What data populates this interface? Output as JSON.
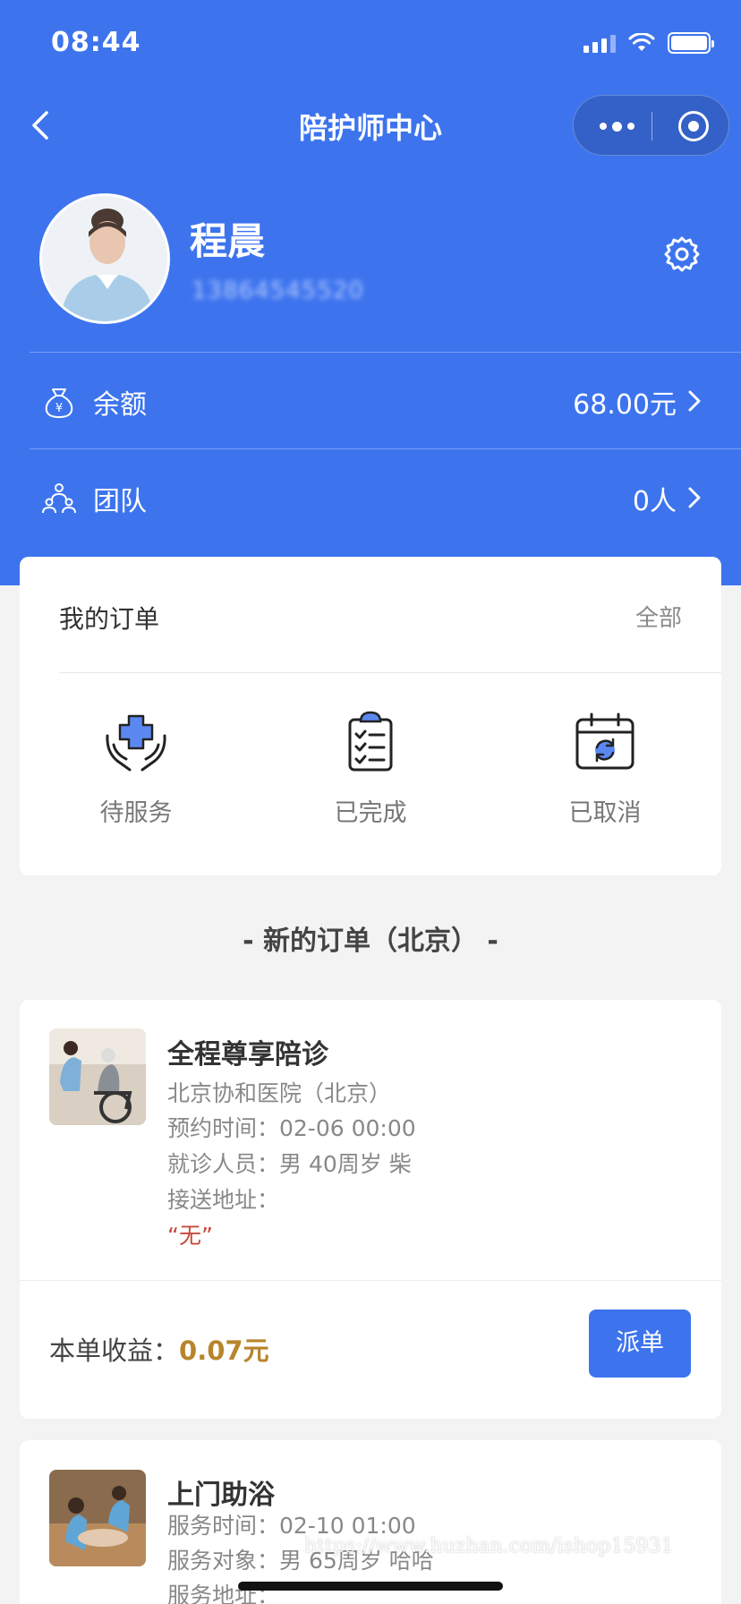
{
  "status_bar": {
    "time": "08:44"
  },
  "nav": {
    "title": "陪护师中心"
  },
  "profile": {
    "name": "程晨",
    "phone": "13864545520"
  },
  "menu": {
    "balance": {
      "label": "余额",
      "value": "68.00元"
    },
    "team": {
      "label": "团队",
      "value": "0人"
    }
  },
  "orders": {
    "title": "我的订单",
    "all_label": "全部",
    "items": [
      {
        "label": "待服务",
        "icon": "medical-care-icon"
      },
      {
        "label": "已完成",
        "icon": "clipboard-check-icon"
      },
      {
        "label": "已取消",
        "icon": "calendar-refresh-icon"
      }
    ]
  },
  "new_orders_title": "- 新的订单（北京） -",
  "order_list": [
    {
      "title": "全程尊享陪诊",
      "lines": [
        "北京协和医院（北京）",
        "预约时间：02-06 00:00",
        "就诊人员：男 40周岁 柴",
        "接送地址："
      ],
      "note": "“无”",
      "earn_label": "本单收益：",
      "earn_value": "0.07元",
      "button": "派单"
    },
    {
      "title": "上门助浴",
      "lines": [
        "服务时间：02-10 01:00",
        "服务对象：男 65周岁 哈哈",
        "服务地址："
      ]
    }
  ],
  "watermark": "https://www.huzhan.com/ishop15931",
  "colors": {
    "primary": "#3d74ee",
    "earn": "#b8852c",
    "note": "#c84a3d"
  }
}
